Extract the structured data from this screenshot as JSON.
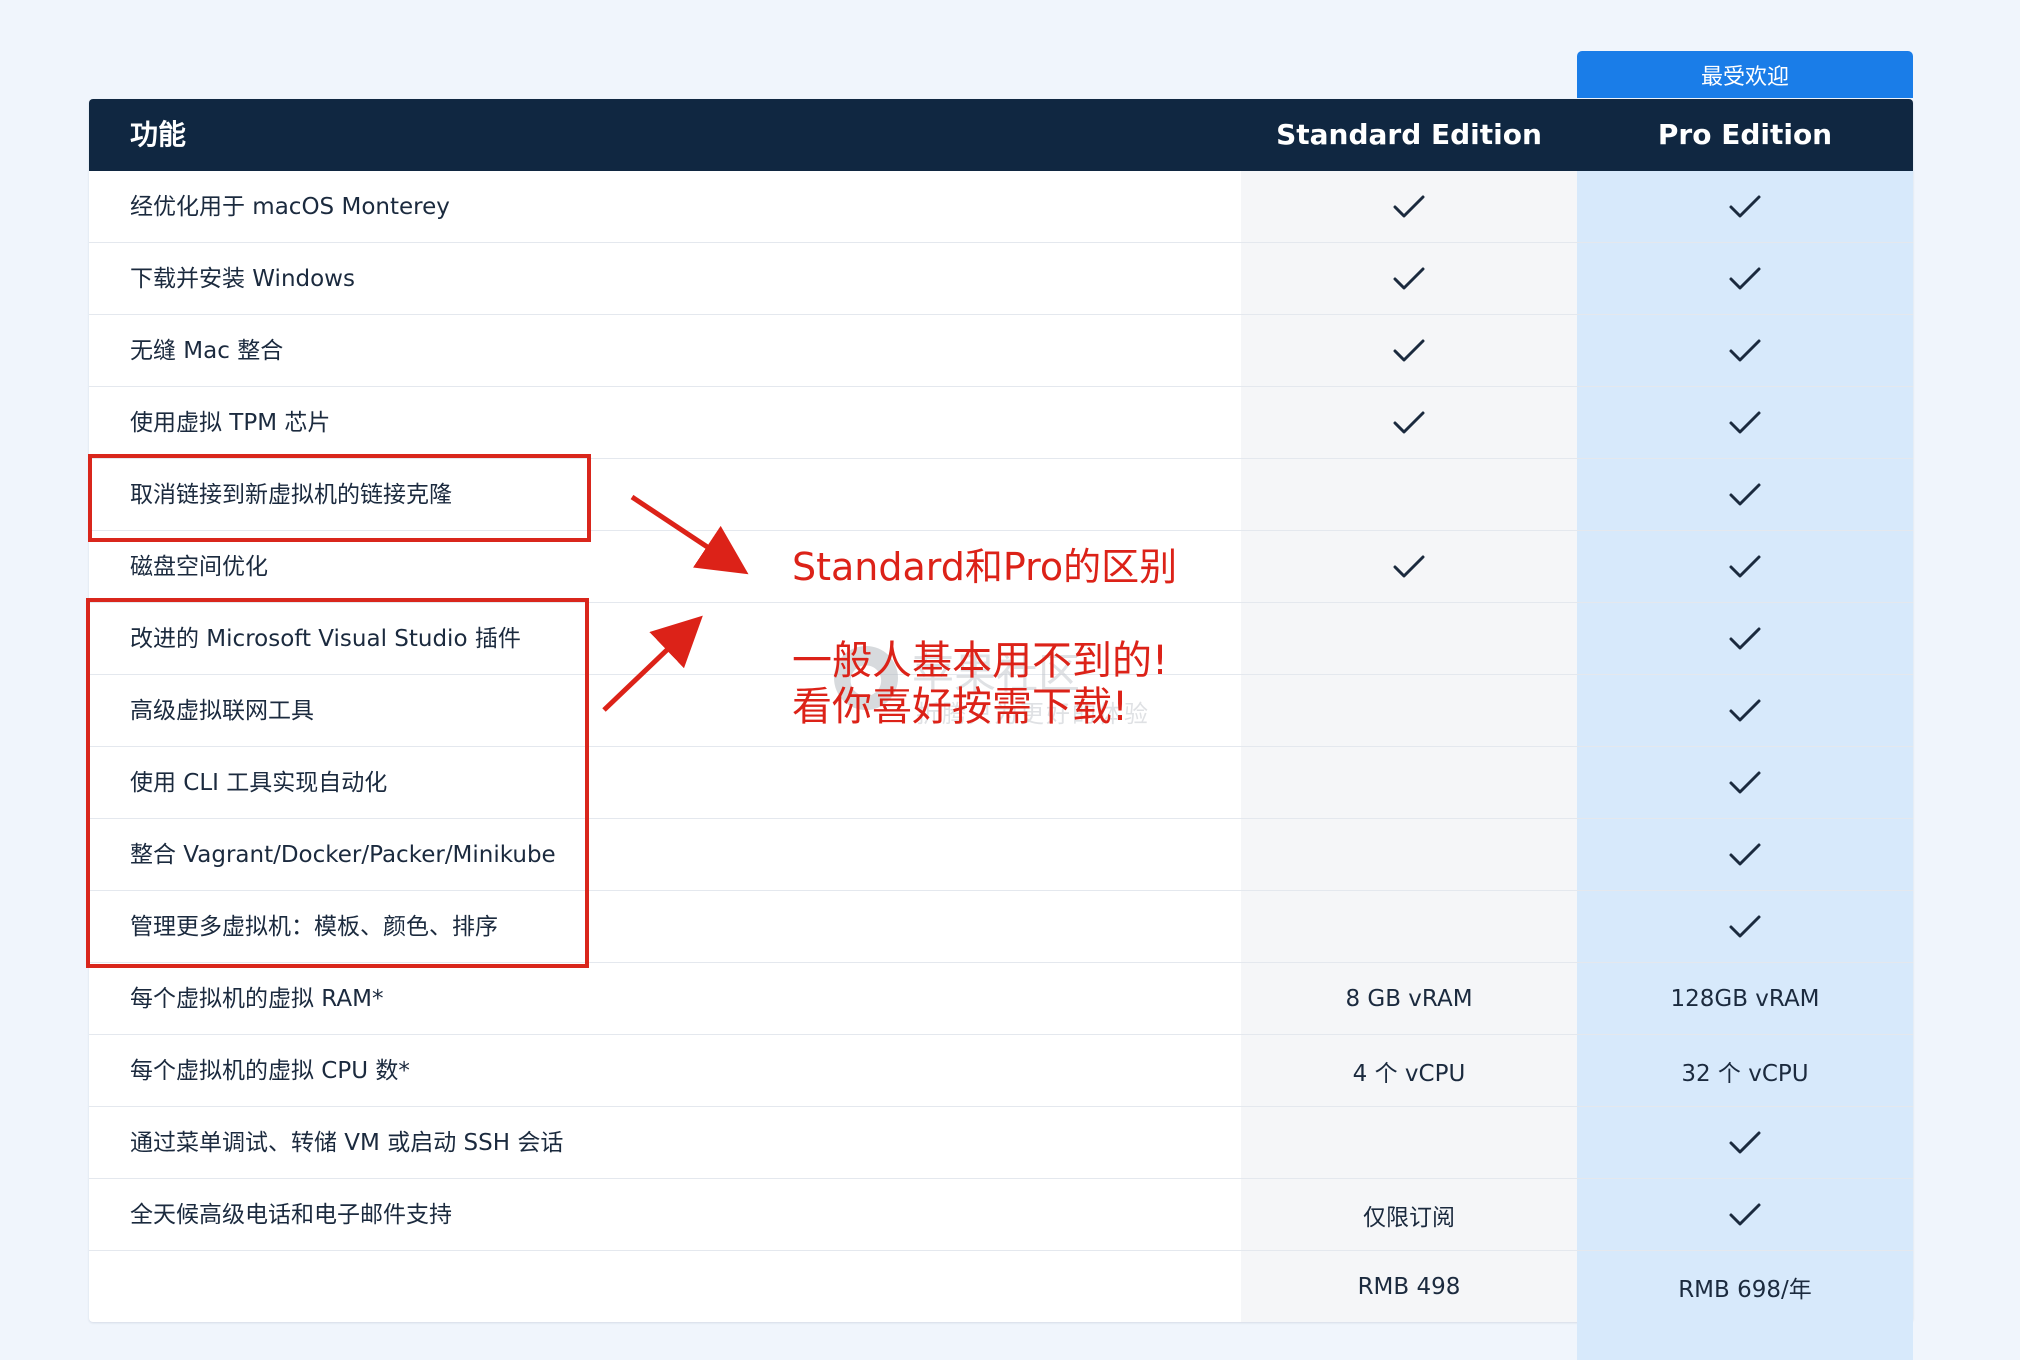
{
  "badge": "最受欢迎",
  "header": {
    "feature": "功能",
    "standard": "Standard Edition",
    "pro": "Pro Edition"
  },
  "rows": [
    {
      "feature": "经优化用于 macOS Monterey",
      "standard": "check",
      "pro": "check"
    },
    {
      "feature": "下载并安装 Windows",
      "standard": "check",
      "pro": "check"
    },
    {
      "feature": "无缝 Mac 整合",
      "standard": "check",
      "pro": "check"
    },
    {
      "feature": "使用虚拟 TPM 芯片",
      "standard": "check",
      "pro": "check"
    },
    {
      "feature": "取消链接到新虚拟机的链接克隆",
      "standard": "",
      "pro": "check"
    },
    {
      "feature": "磁盘空间优化",
      "standard": "check",
      "pro": "check"
    },
    {
      "feature": "改进的 Microsoft Visual Studio 插件",
      "standard": "",
      "pro": "check"
    },
    {
      "feature": "高级虚拟联网工具",
      "standard": "",
      "pro": "check"
    },
    {
      "feature": "使用 CLI 工具实现自动化",
      "standard": "",
      "pro": "check"
    },
    {
      "feature": "整合 Vagrant/Docker/Packer/Minikube",
      "standard": "",
      "pro": "check"
    },
    {
      "feature": "管理更多虚拟机：模板、颜色、排序",
      "standard": "",
      "pro": "check"
    },
    {
      "feature": "每个虚拟机的虚拟 RAM*",
      "standard": "8 GB vRAM",
      "pro": "128GB vRAM"
    },
    {
      "feature": "每个虚拟机的虚拟 CPU 数*",
      "standard": "4 个 vCPU",
      "pro": "32 个 vCPU"
    },
    {
      "feature": "通过菜单调试、转储 VM 或启动 SSH 会话",
      "standard": "",
      "pro": "check"
    },
    {
      "feature": "全天候高级电话和电子邮件支持",
      "standard": "仅限订阅",
      "pro": "check"
    },
    {
      "feature": "",
      "standard": "RMB 498",
      "pro": "RMB 698/年"
    }
  ],
  "annotation": {
    "title": "Standard和Pro的区别",
    "line1": "一般人基本用不到的!",
    "line2": "看你喜好按需下载!",
    "color": "#dc2218"
  },
  "watermark": {
    "name": "苹果社区",
    "slogan": "折腾只为更好的体验"
  },
  "colors": {
    "header_bg": "#102741",
    "badge_bg": "#1a7de8",
    "pro_column_bg": "#d7e9fb",
    "standard_column_bg": "#f5f6f8"
  }
}
